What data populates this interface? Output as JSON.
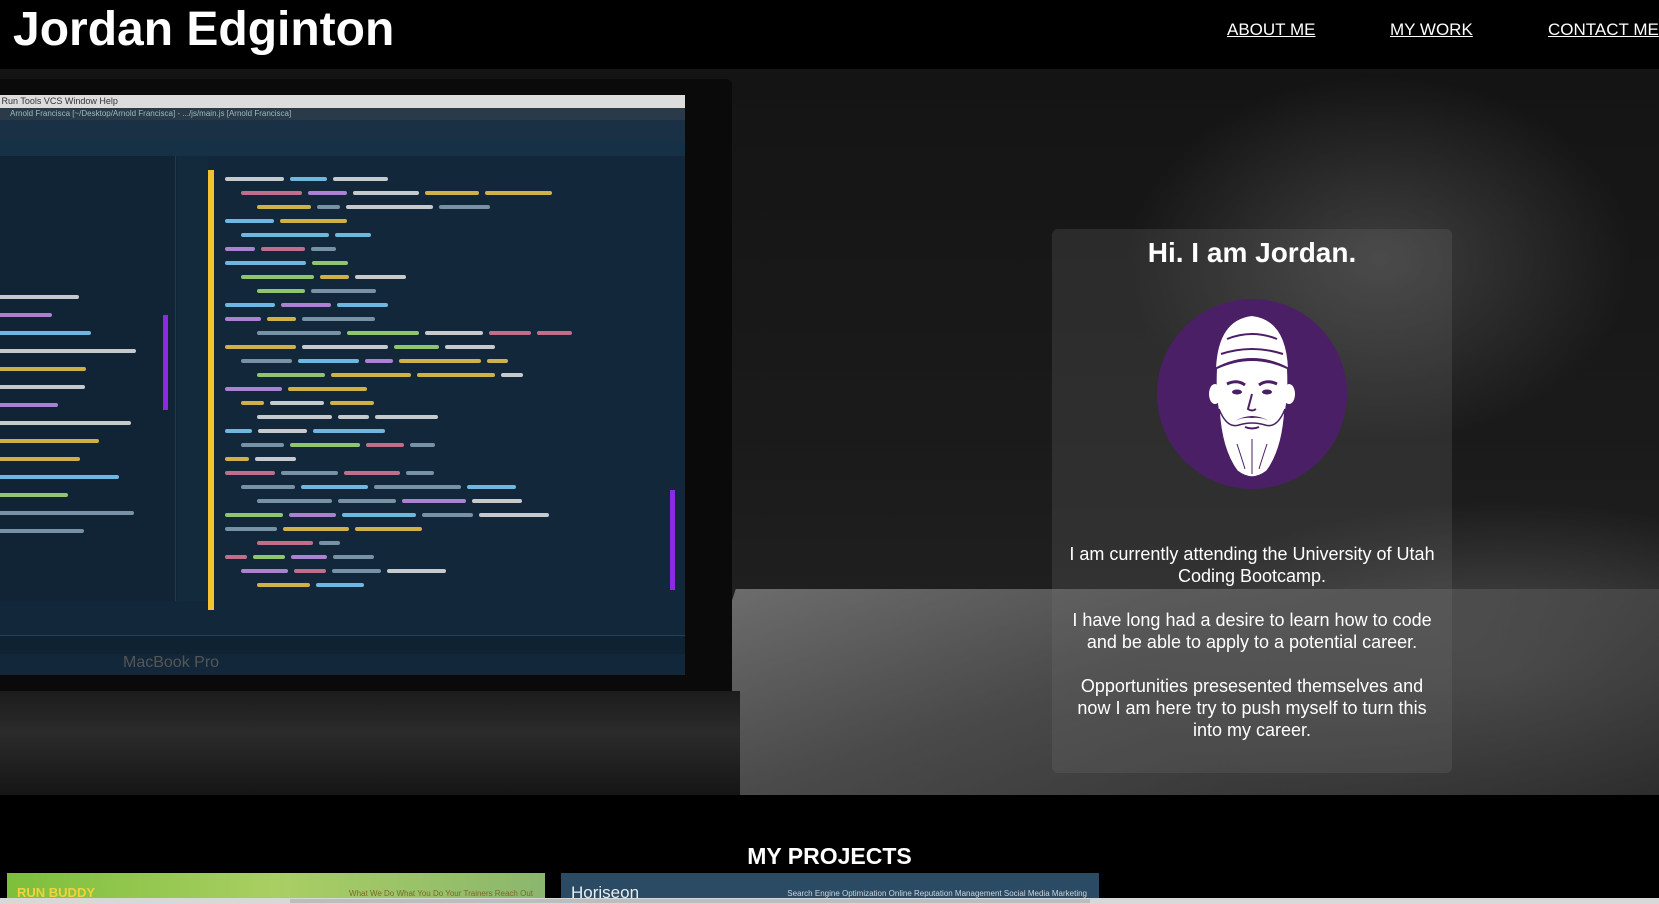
{
  "header": {
    "title": "Jordan Edginton",
    "nav": {
      "about": "ABOUT ME",
      "work": "MY WORK",
      "contact": "CONTACT ME"
    }
  },
  "hero": {
    "screen_menu": "ctor   Run   Tools   VCS   Window   Help",
    "screen_path": "Arnold Francisca [~/Desktop/Arnold Francisca] - .../js/main.js [Arnold Francisca]",
    "laptop_label": "MacBook Pro"
  },
  "about": {
    "heading": "Hi. I am Jordan.",
    "paragraph_1": "I am currently attending the University of Utah Coding Bootcamp.",
    "paragraph_2": "I have long had a desire to learn how to code and be able to apply to a potential career.",
    "paragraph_3": "Opportunities presesented themselves and now I am here try to push myself to turn this into my career."
  },
  "projects": {
    "heading": "MY PROJECTS",
    "items": [
      {
        "title": "RUN BUDDY",
        "nav": "What We Do    What You Do    Your Trainers    Reach Out"
      },
      {
        "title": "Horiseon",
        "nav": "Search Engine Optimization    Online Reputation Management    Social Media Marketing"
      }
    ]
  },
  "colors": {
    "background": "#000000",
    "avatar_bg": "#4b1f66",
    "text": "#ffffff"
  }
}
